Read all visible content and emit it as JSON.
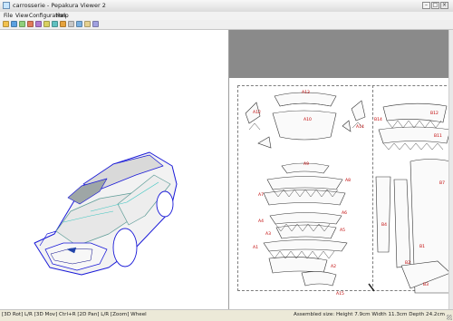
{
  "window": {
    "title": "carrosserie - Pepakura Viewer 2"
  },
  "menu": {
    "items": [
      "File",
      "View",
      "Configuration",
      "Help"
    ]
  },
  "toolbar": {
    "buttons": [
      "open",
      "save",
      "3d-view",
      "2d-view",
      "flat",
      "texture",
      "edge",
      "zoom-in",
      "zoom-out",
      "print",
      "settings",
      "info"
    ]
  },
  "parts": {
    "labels": [
      "A13",
      "A12",
      "A10",
      "A14",
      "A9",
      "A7",
      "A8",
      "A4",
      "A6",
      "A3",
      "A5",
      "A1",
      "A2",
      "A15",
      "B14",
      "B12",
      "B11",
      "B7",
      "B4",
      "B2",
      "B1",
      "B3"
    ]
  },
  "status": {
    "controls": "[3D Rot] L/R [3D Mov] Ctrl+R [2D Pan] L/R [Zoom] Wheel",
    "assembled": "Assembled size: Height 7.9cm Width 11.3cm Depth 24.2cm"
  }
}
